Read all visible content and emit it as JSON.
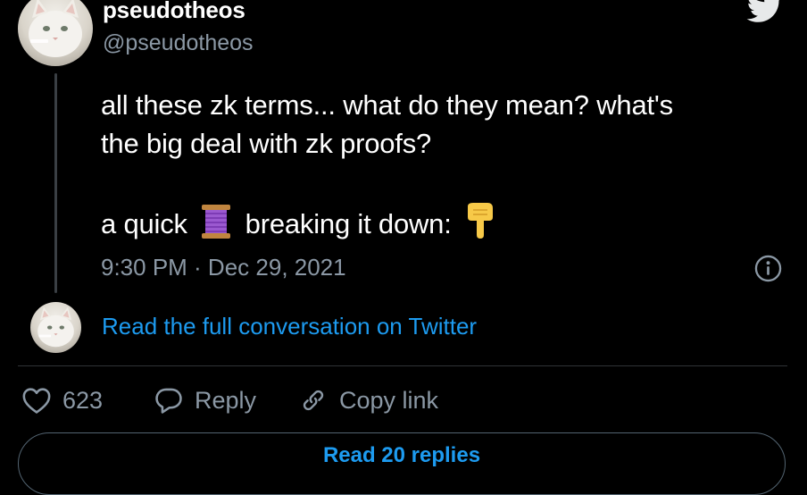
{
  "tweet": {
    "display_name": "pseudotheos",
    "handle": "@pseudotheos",
    "text_line1": "all these zk terms... what do they mean? what's",
    "text_line2": "the big deal with zk proofs?",
    "text_line3_before": "a quick",
    "text_line3_middle": "breaking it down:",
    "thread_emoji_icon": "thread-spool-icon",
    "pointing_emoji_icon": "pointing-down-hand-icon",
    "timestamp": "9:30 PM · Dec 29, 2021"
  },
  "conversation_link": "Read the full conversation on Twitter",
  "actions": {
    "like_count": "623",
    "reply_label": "Reply",
    "copy_link_label": "Copy link"
  },
  "read_replies_label": "Read 20 replies",
  "colors": {
    "background": "#000000",
    "primary_text": "#ffffff",
    "secondary_text": "#8b98a5",
    "link_blue": "#1d9bf0",
    "divider": "#2f3336"
  }
}
